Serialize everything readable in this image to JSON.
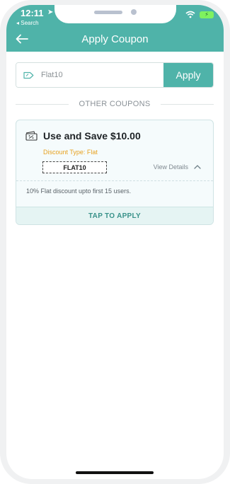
{
  "status_bar": {
    "time": "12:11",
    "location_icon": "location-arrow-icon",
    "back_app": "◂ Search",
    "wifi_icon": "wifi-icon",
    "battery_icon": "battery-charging-icon"
  },
  "header": {
    "title": "Apply Coupon",
    "back_icon": "arrow-left-icon",
    "background": "#4fb3a9"
  },
  "coupon_input": {
    "icon": "tag-icon",
    "value": "Flat10",
    "apply_label": "Apply"
  },
  "section_label": "OTHER COUPONS",
  "coupons": [
    {
      "icon": "coupon-ticket-icon",
      "title": "Use and Save $10.00",
      "discount_type": "Discount Type: Flat",
      "code": "FLAT10",
      "details_label": "View Details",
      "details_icon": "chevron-up-icon",
      "description": "10% Flat discount upto first 15 users.",
      "action_label": "TAP TO APPLY"
    }
  ],
  "colors": {
    "accent": "#4fb3a9",
    "discount_type": "#e7a11f",
    "card_bg": "#f5fbfc"
  }
}
